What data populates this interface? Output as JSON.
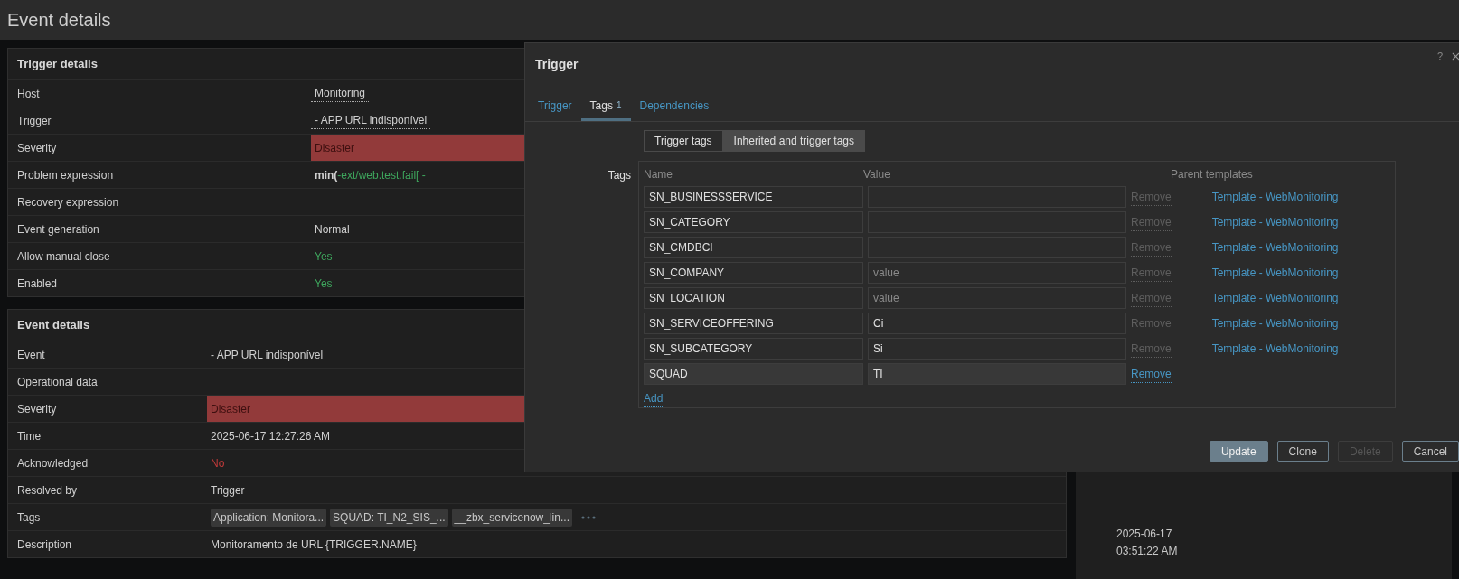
{
  "page_title": "Event details",
  "trigger_details": {
    "title": "Trigger details",
    "rows": [
      {
        "label": "Host",
        "value": "Monitoring",
        "kind": "link"
      },
      {
        "label": "Trigger",
        "value": "- APP URL indisponível",
        "kind": "link"
      },
      {
        "label": "Severity",
        "value": "Disaster",
        "kind": "severity"
      },
      {
        "label": "Problem expression",
        "value": "**min(**-ext/web.test.fail[ -",
        "kind": "expression"
      },
      {
        "label": "Recovery expression",
        "kind": "text"
      },
      {
        "label": "Event generation",
        "value": "Normal",
        "kind": "text"
      },
      {
        "label": "Allow manual close",
        "value": "Yes",
        "kind": "yes"
      },
      {
        "label": "Enabled",
        "value": "Yes",
        "kind": "yes"
      }
    ]
  },
  "event_details": {
    "title": "Event details",
    "rows": [
      {
        "label": "Event",
        "value": "- APP URL indisponível",
        "kind": "text"
      },
      {
        "label": "Operational data",
        "kind": "text"
      },
      {
        "label": "Severity",
        "value": "Disaster",
        "kind": "severity"
      },
      {
        "label": "Time",
        "value": "2025-06-17 12:27:26 AM",
        "kind": "text"
      },
      {
        "label": "Acknowledged",
        "value": "No",
        "kind": "no"
      },
      {
        "label": "Resolved by",
        "value": "Trigger",
        "kind": "text"
      },
      {
        "label": "Tags",
        "kind": "tags",
        "tags": [
          "Application: Monitora...",
          "SQUAD: TI_N2_SIS_...",
          "__zbx_servicenow_lin..."
        ]
      },
      {
        "label": "Description",
        "value": "Monitoramento de URL {TRIGGER.NAME}",
        "kind": "text"
      }
    ]
  },
  "side_row": {
    "time": "2025-06-17 03:51:22 AM"
  },
  "dialog": {
    "title": "Trigger",
    "help": "?",
    "tabs": [
      {
        "label": "Trigger",
        "selected": false
      },
      {
        "label": "Tags",
        "count": "1",
        "selected": true
      },
      {
        "label": "Dependencies",
        "selected": false
      }
    ],
    "tag_filters": [
      {
        "label": "Trigger tags",
        "selected": false
      },
      {
        "label": "Inherited and trigger tags",
        "selected": true
      }
    ],
    "tags_label": "Tags",
    "columns": [
      "Name",
      "Value",
      "Parent templates"
    ],
    "rows": [
      {
        "name": "SN_BUSINESSSERVICE",
        "remove": "Remove",
        "inherited": true,
        "parent": "Template - WebMonitoring"
      },
      {
        "name": "SN_CATEGORY",
        "remove": "Remove",
        "inherited": true,
        "parent": "Template - WebMonitoring"
      },
      {
        "name": "SN_CMDBCI",
        "remove": "Remove",
        "inherited": true,
        "parent": "Template - WebMonitoring"
      },
      {
        "name": "SN_COMPANY",
        "placeholder": "value",
        "remove": "Remove",
        "inherited": true,
        "parent": "Template - WebMonitoring"
      },
      {
        "name": "SN_LOCATION",
        "placeholder": "value",
        "remove": "Remove",
        "inherited": true,
        "parent": "Template - WebMonitoring"
      },
      {
        "name": "SN_SERVICEOFFERING",
        "value": "Ci",
        "remove": "Remove",
        "inherited": true,
        "parent": "Template - WebMonitoring"
      },
      {
        "name": "SN_SUBCATEGORY",
        "value": "Si",
        "remove": "Remove",
        "inherited": true,
        "parent": "Template - WebMonitoring"
      },
      {
        "name": "SQUAD",
        "value": "TI",
        "remove": "Remove",
        "inherited": false
      }
    ],
    "add": "Add",
    "buttons": [
      {
        "label": "Update",
        "kind": "primary",
        "disabled": false
      },
      {
        "label": "Clone",
        "kind": "secondary",
        "disabled": false
      },
      {
        "label": "Delete",
        "kind": "secondary",
        "disabled": true
      },
      {
        "label": "Cancel",
        "kind": "secondary",
        "disabled": false
      }
    ]
  }
}
